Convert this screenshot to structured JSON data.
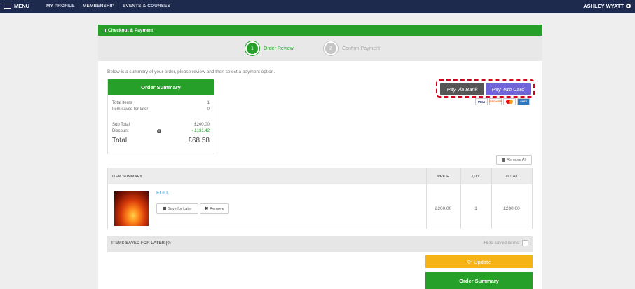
{
  "nav": {
    "menu_label": "MENU",
    "links": [
      "MY PROFILE",
      "MEMBERSHIP",
      "EVENTS & COURSES"
    ],
    "user_name": "ASHLEY WYATT"
  },
  "panel": {
    "title": "Checkout & Payment",
    "steps": [
      {
        "num": "1",
        "label": "Order Review"
      },
      {
        "num": "2",
        "label": "Confirm Payment"
      }
    ],
    "intro": "Below is a summary of your order, please review and then select a payment option."
  },
  "summary": {
    "title": "Order Summary",
    "total_items_label": "Total items",
    "total_items": "1",
    "saved_label": "Item saved for later",
    "saved": "0",
    "subtotal_label": "Sub Total",
    "subtotal": "£200.00",
    "discount_label": "Discount",
    "discount": "- £131.42",
    "total_label": "Total",
    "total": "£68.58"
  },
  "payment": {
    "bank_label": "Pay via Bank",
    "card_label": "Pay with Card",
    "cards": [
      "VISA",
      "DISCOVER",
      "mastercard",
      "AMEX"
    ]
  },
  "remove_all_label": "Remove All",
  "table": {
    "headers": [
      "ITEM SUMMARY",
      "PRICE",
      "QTY",
      "TOTAL"
    ],
    "item": {
      "name": "FULL",
      "save_label": "Save for Later",
      "remove_label": "Remove",
      "price": "£200.00",
      "qty": "1",
      "total": "£200.00"
    }
  },
  "saved_bar": {
    "label": "ITEMS SAVED FOR LATER (0)",
    "hide_label": "Hide saved items:"
  },
  "buttons": {
    "update": "Update",
    "order_summary": "Order Summary"
  },
  "colors": {
    "nav": "#1d2a4d",
    "green": "#27a02a",
    "card_button": "#6f64d8",
    "bank_button": "#555555",
    "update_button": "#f5b316",
    "highlight": "#d0021b"
  }
}
